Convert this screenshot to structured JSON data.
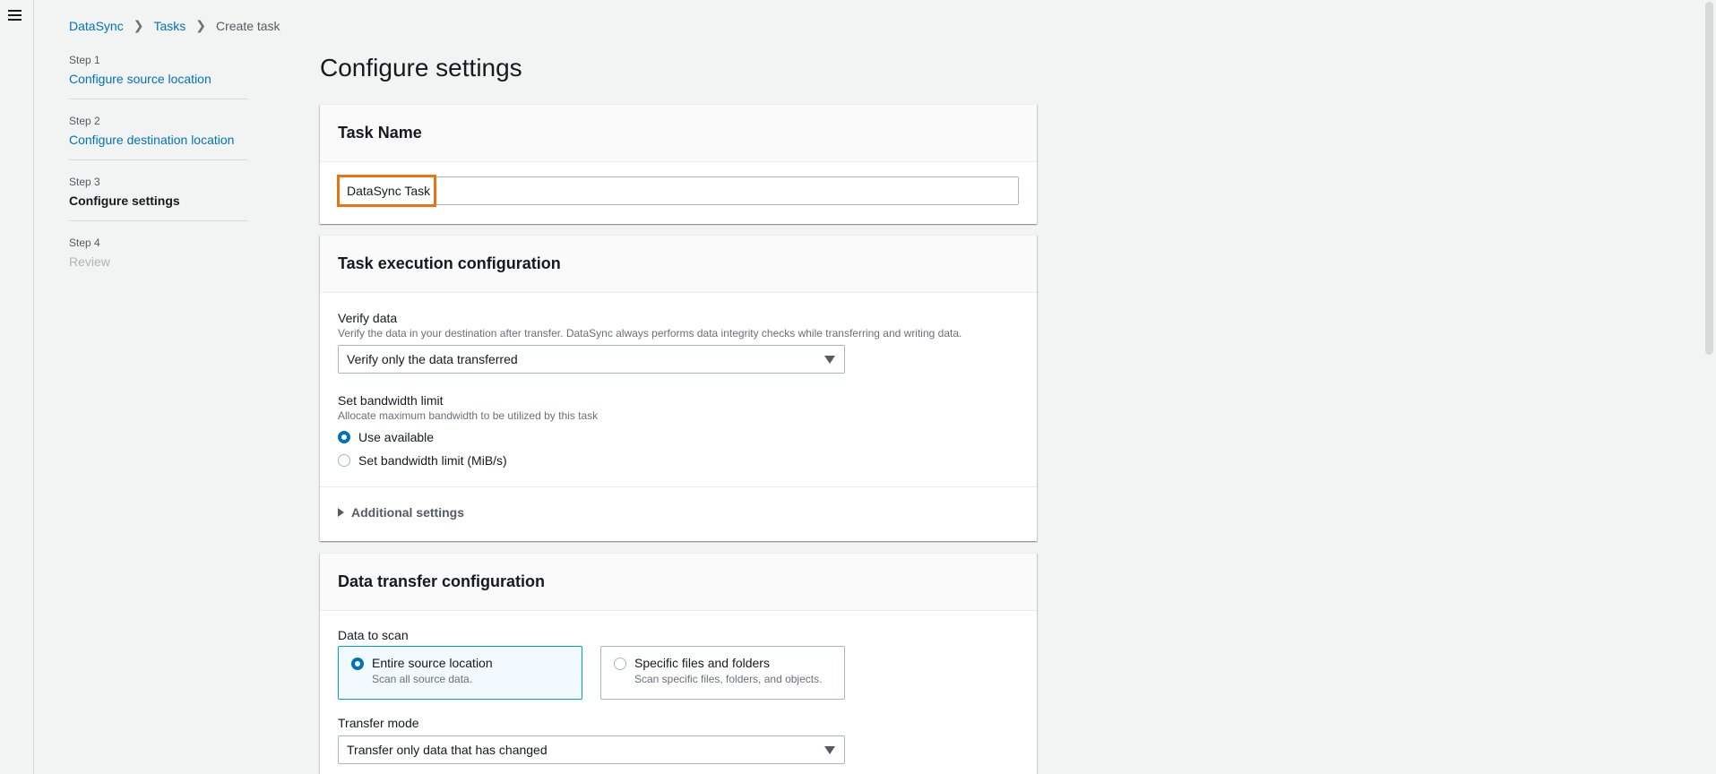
{
  "breadcrumb": {
    "items": [
      "DataSync",
      "Tasks"
    ],
    "current": "Create task"
  },
  "steps": [
    {
      "num": "Step 1",
      "label": "Configure source location",
      "state": "link"
    },
    {
      "num": "Step 2",
      "label": "Configure destination location",
      "state": "link"
    },
    {
      "num": "Step 3",
      "label": "Configure settings",
      "state": "active"
    },
    {
      "num": "Step 4",
      "label": "Review",
      "state": "disabled"
    }
  ],
  "page_title": "Configure settings",
  "task_name": {
    "header": "Task Name",
    "value": "DataSync Task"
  },
  "execution": {
    "header": "Task execution configuration",
    "verify_label": "Verify data",
    "verify_desc": "Verify the data in your destination after transfer. DataSync always performs data integrity checks while transferring and writing data.",
    "verify_value": "Verify only the data transferred",
    "bandwidth_label": "Set bandwidth limit",
    "bandwidth_desc": "Allocate maximum bandwidth to be utilized by this task",
    "bandwidth_options": [
      "Use available",
      "Set bandwidth limit (MiB/s)"
    ],
    "additional_settings": "Additional settings"
  },
  "transfer": {
    "header": "Data transfer configuration",
    "scan_label": "Data to scan",
    "tiles": [
      {
        "title": "Entire source location",
        "desc": "Scan all source data."
      },
      {
        "title": "Specific files and folders",
        "desc": "Scan specific files, folders, and objects."
      }
    ],
    "mode_label": "Transfer mode",
    "mode_value": "Transfer only data that has changed"
  },
  "colors": {
    "accent": "#0073bb",
    "highlight": "#ec7211"
  }
}
